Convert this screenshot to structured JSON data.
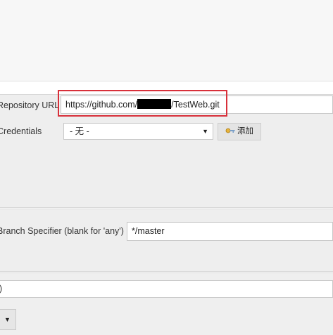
{
  "repository": {
    "label": "Repository URL",
    "url_prefix": "https://github.com/",
    "url_suffix": "/TestWeb.git"
  },
  "credentials": {
    "label": "Credentials",
    "selected": "- 无 -",
    "add_button_label": "添加"
  },
  "branch": {
    "label": "Branch Specifier (blank for 'any')",
    "value": "*/master"
  },
  "bottom": {
    "field_value": ")"
  },
  "colors": {
    "highlight": "#d8303a"
  }
}
